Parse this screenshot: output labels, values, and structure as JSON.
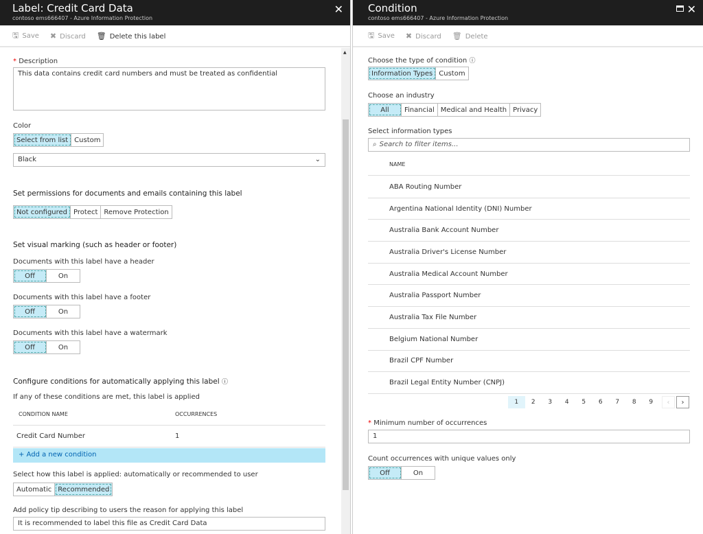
{
  "left": {
    "title": "Label: Credit Card Data",
    "subtitle": "contoso ems666407 - Azure Information Protection",
    "toolbar": {
      "save": "Save",
      "discard": "Discard",
      "delete": "Delete this label"
    },
    "description_label": "Description",
    "description_value": "This data contains credit card numbers and must be treated as confidential",
    "color_label": "Color",
    "color_options": [
      "Select from list",
      "Custom"
    ],
    "color_value": "Black",
    "permissions_heading": "Set permissions for documents and emails containing this label",
    "permissions_options": [
      "Not configured",
      "Protect",
      "Remove Protection"
    ],
    "marking_heading": "Set visual marking (such as header or footer)",
    "header_label": "Documents with this label have a header",
    "footer_label": "Documents with this label have a footer",
    "watermark_label": "Documents with this label have a watermark",
    "off": "Off",
    "on": "On",
    "conditions_heading": "Configure conditions for automatically applying this label",
    "conditions_sub": "If any of these conditions are met, this label is applied",
    "col_name": "CONDITION NAME",
    "col_occ": "OCCURRENCES",
    "conditions": [
      {
        "name": "Credit Card Number",
        "occ": "1"
      }
    ],
    "add_condition": "+ Add a new condition",
    "apply_label": "Select how this label is applied: automatically or recommended to user",
    "apply_options": [
      "Automatic",
      "Recommended"
    ],
    "tip_label": "Add policy tip describing to users the reason for applying this label",
    "tip_value": "It is recommended to label this file as Credit Card Data"
  },
  "right": {
    "title": "Condition",
    "subtitle": "contoso ems666407 - Azure Information Protection",
    "toolbar": {
      "save": "Save",
      "discard": "Discard",
      "delete": "Delete"
    },
    "type_label": "Choose the type of condition",
    "type_options": [
      "Information Types",
      "Custom"
    ],
    "industry_label": "Choose an industry",
    "industry_options": [
      "All",
      "Financial",
      "Medical and Health",
      "Privacy"
    ],
    "select_label": "Select information types",
    "search_placeholder": "Search to filter items...",
    "col_name": "NAME",
    "items": [
      "ABA Routing Number",
      "Argentina National Identity (DNI) Number",
      "Australia Bank Account Number",
      "Australia Driver's License Number",
      "Australia Medical Account Number",
      "Australia Passport Number",
      "Australia Tax File Number",
      "Belgium National Number",
      "Brazil CPF Number",
      "Brazil Legal Entity Number (CNPJ)"
    ],
    "pages": [
      "1",
      "2",
      "3",
      "4",
      "5",
      "6",
      "7",
      "8",
      "9"
    ],
    "current_page": "1",
    "min_label": "Minimum number of occurrences",
    "min_value": "1",
    "unique_label": "Count occurrences with unique values only",
    "off": "Off",
    "on": "On"
  },
  "colors": {
    "header_bg": "#1e1e1e",
    "selected": "#c5ebf7",
    "add_bar": "#b3e6f7"
  }
}
